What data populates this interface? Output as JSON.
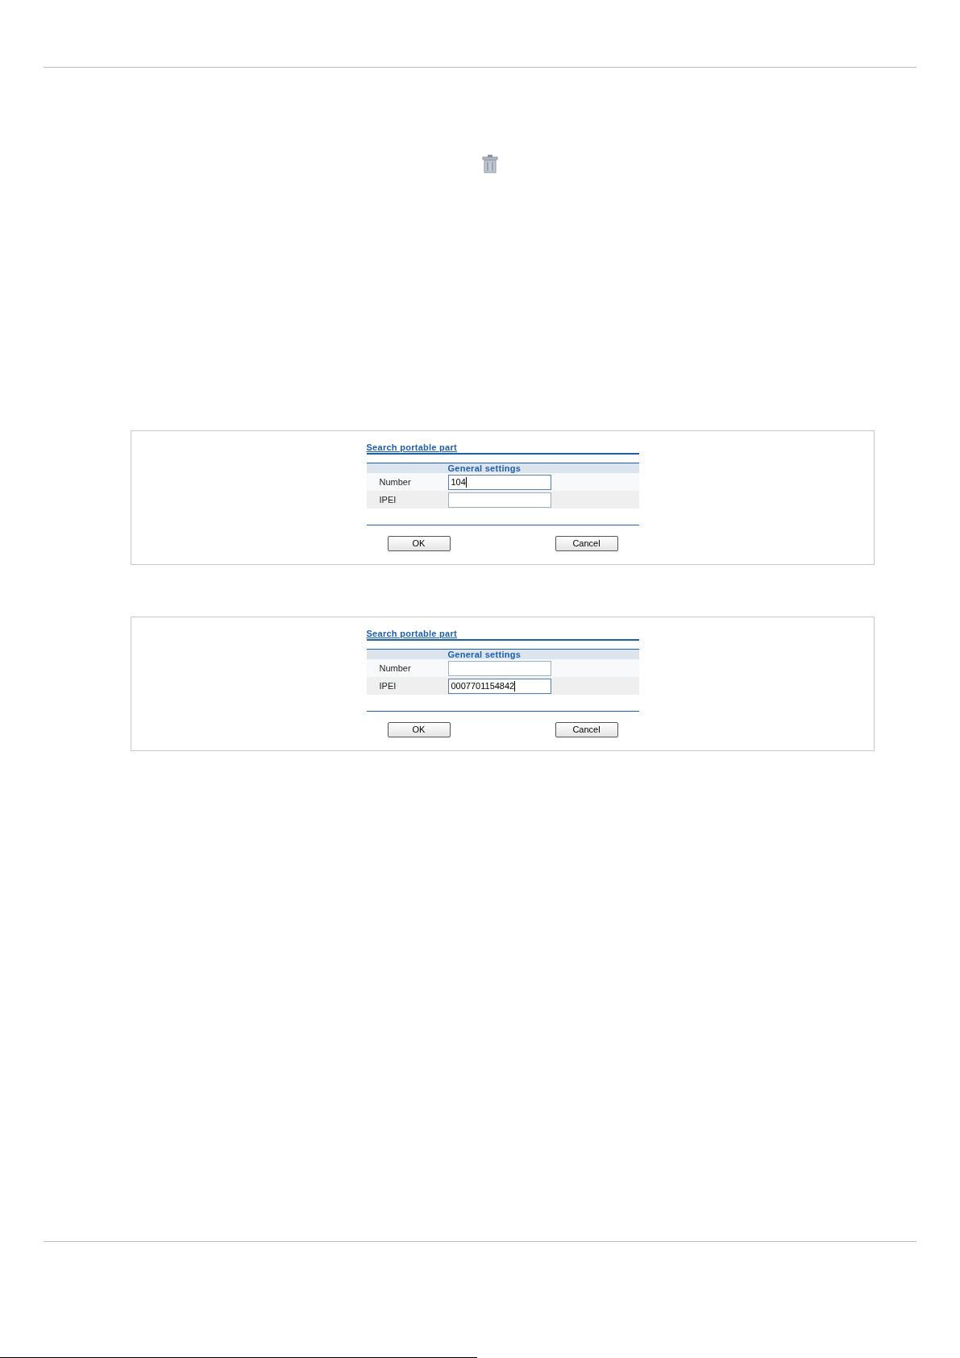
{
  "dialogs": [
    {
      "title": "Search portable part",
      "section": "General settings",
      "fields": [
        {
          "label": "Number",
          "value": "104",
          "focused": true
        },
        {
          "label": "IPEI",
          "focused": false
        }
      ],
      "buttons": [
        "OK",
        "Cancel"
      ]
    },
    {
      "title": "Search portable part",
      "section": "General settings",
      "fields": [
        {
          "label": "Number",
          "focused": false
        },
        {
          "label": "IPEI",
          "value": "0007701154842",
          "focused": true
        }
      ],
      "buttons": [
        "OK",
        "Cancel"
      ]
    }
  ]
}
